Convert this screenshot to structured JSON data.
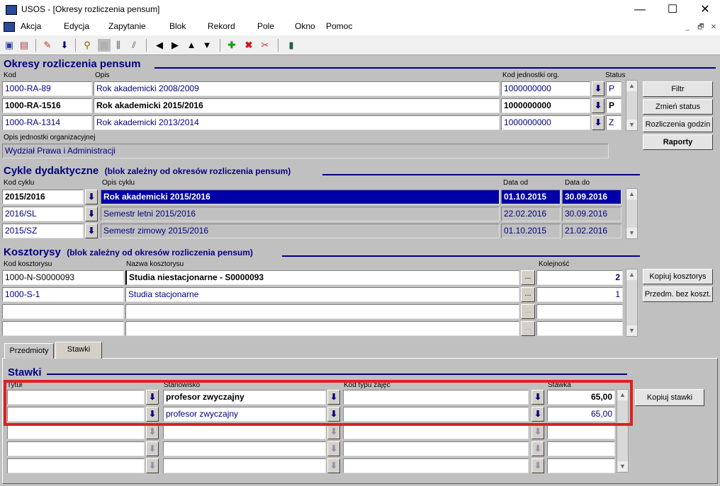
{
  "window": {
    "title": "USOS - [Okresy rozliczenia pensum]",
    "minimize": "—",
    "maximize": "☐",
    "close": "✕"
  },
  "menu": [
    {
      "label": "Akcja"
    },
    {
      "label": "Edycja"
    },
    {
      "label": "Zapytanie"
    },
    {
      "label": "Blok"
    },
    {
      "label": "Rekord"
    },
    {
      "label": "Pole"
    },
    {
      "label": "Okno"
    },
    {
      "label": "Pomoc"
    }
  ],
  "mdi_controls": {
    "minimize": "_",
    "restore": "🗗",
    "close": "✕"
  },
  "toolbar_icons": [
    "save-icon",
    "print-preview-icon",
    "edit-icon",
    "download-icon",
    "enter-query-icon",
    "execute-query-icon",
    "count-icon",
    "stats-icon",
    "prev-block-icon",
    "next-block-icon",
    "prev-record-icon",
    "next-record-icon",
    "insert-record-icon",
    "delete-record-icon",
    "clear-record-icon",
    "exit-icon"
  ],
  "okresy": {
    "title": "Okresy rozliczenia pensum",
    "col_kod": "Kod",
    "col_opis": "Opis",
    "col_jedn": "Kod jednostki org.",
    "col_status": "Status",
    "rows": [
      {
        "kod": "1000-RA-89",
        "opis": "Rok akademicki 2008/2009",
        "jedn": "1000000000",
        "status": "P"
      },
      {
        "kod": "1000-RA-1516",
        "opis": "Rok akademicki 2015/2016",
        "jedn": "1000000000",
        "status": "P"
      },
      {
        "kod": "1000-RA-1314",
        "opis": "Rok akademicki 2013/2014",
        "jedn": "1000000000",
        "status": "Z"
      }
    ],
    "opis_jedn_label": "Opis jednostki organizacyjnej",
    "opis_jedn_value": "Wydział Prawa i Administracji",
    "buttons": {
      "filtr": "Filtr",
      "zmien_status": "Zmień status",
      "rozliczenia": "Rozliczenia godzin",
      "raporty": "Raporty"
    }
  },
  "cykle": {
    "title": "Cykle dydaktyczne",
    "subtitle": "(blok zależny od okresów rozliczenia pensum)",
    "col_kod": "Kod cyklu",
    "col_opis": "Opis cyklu",
    "col_od": "Data od",
    "col_do": "Data do",
    "rows": [
      {
        "kod": "2015/2016",
        "opis": "Rok akademicki 2015/2016",
        "od": "01.10.2015",
        "do": "30.09.2016"
      },
      {
        "kod": "2016/SL",
        "opis": "Semestr letni 2015/2016",
        "od": "22.02.2016",
        "do": "30.09.2016"
      },
      {
        "kod": "2015/SZ",
        "opis": "Semestr zimowy 2015/2016",
        "od": "01.10.2015",
        "do": "21.02.2016"
      }
    ]
  },
  "kosztorysy": {
    "title": "Kosztorysy",
    "subtitle": "(blok zależny od okresów rozliczenia pensum)",
    "col_kod": "Kod kosztorysu",
    "col_nazwa": "Nazwa kosztorysu",
    "col_kolejnosc": "Kolejność",
    "rows": [
      {
        "kod": "1000-N-S0000093",
        "nazwa": "Studia niestacjonarne - S0000093",
        "kolejnosc": "2"
      },
      {
        "kod": "1000-S-1",
        "nazwa": "Studia stacjonarne",
        "kolejnosc": "1"
      }
    ],
    "buttons": {
      "kopiuj": "Kopiuj kosztorys",
      "przedm": "Przedm. bez koszt."
    }
  },
  "tabs": [
    {
      "label": "Przedmioty"
    },
    {
      "label": "Stawki"
    }
  ],
  "stawki": {
    "title": "Stawki",
    "col_tytul": "Tytuł",
    "col_stanowisko": "Stanowisko",
    "col_kod_typu": "Kod typu zajęć",
    "col_stawka": "Stawka",
    "rows": [
      {
        "tytul": "",
        "stanowisko": "profesor zwyczajny",
        "kod_typu": "",
        "stawka": "65,00"
      },
      {
        "tytul": "",
        "stanowisko": "profesor zwyczajny",
        "kod_typu": "",
        "stawka": "65,00"
      }
    ],
    "buttons": {
      "kopiuj": "Kopiuj stawki"
    }
  },
  "colors": {
    "accent": "#000080",
    "selection": "#0000a8",
    "highlight": "#e02020"
  }
}
